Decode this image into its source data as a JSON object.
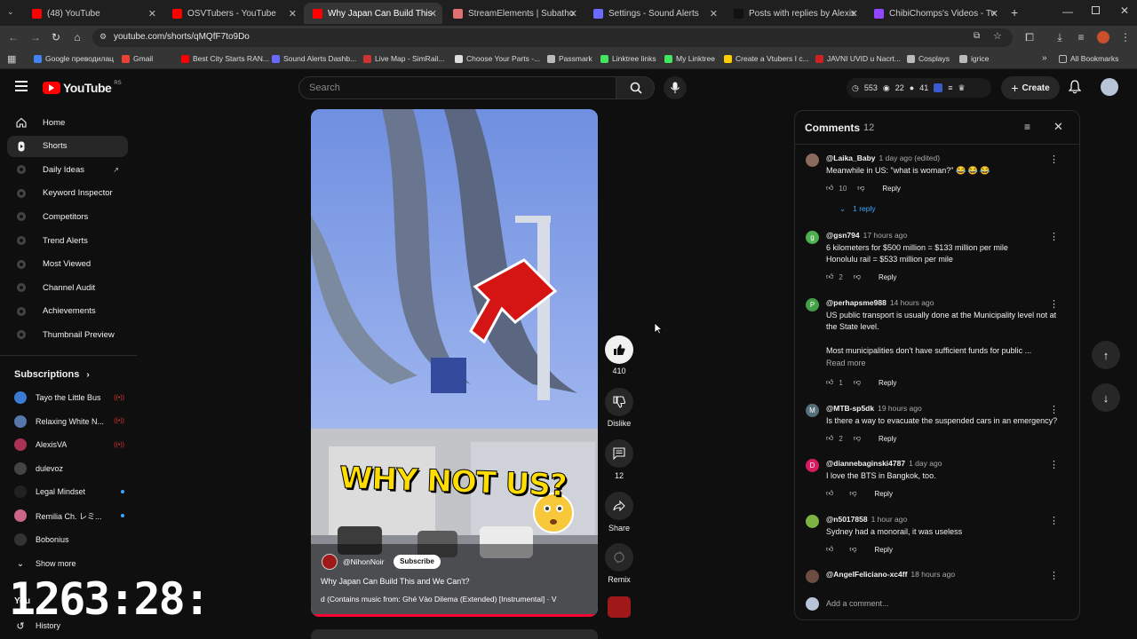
{
  "browser": {
    "tabs": [
      {
        "title": "(48) YouTube",
        "color": "#ff0000",
        "active": false
      },
      {
        "title": "OSVTubers - YouTube",
        "color": "#ff0000",
        "active": false
      },
      {
        "title": "Why Japan Can Build This a",
        "color": "#ff0000",
        "active": true
      },
      {
        "title": "StreamElements | Subathon Co",
        "color": "#e07070",
        "active": false
      },
      {
        "title": "Settings - Sound Alerts",
        "color": "#6a6aff",
        "active": false
      },
      {
        "title": "Posts with replies by Alexis 2.c",
        "color": "#111111",
        "active": false
      },
      {
        "title": "ChibiChomps's Videos - Twitch",
        "color": "#9146ff",
        "active": false
      }
    ],
    "url": "youtube.com/shorts/qMQfF7to9Do",
    "bookmarks": [
      {
        "label": "Google преводилац",
        "color": "#4285f4"
      },
      {
        "label": "Gmail",
        "color": "#ea4335"
      },
      {
        "label": "Best City Starts RAN...",
        "color": "#ff0000"
      },
      {
        "label": "Sound Alerts Dashb...",
        "color": "#6a6aff"
      },
      {
        "label": "Live Map - SimRail...",
        "color": "#cc3333"
      },
      {
        "label": "Choose Your Parts -...",
        "color": "#dddddd"
      },
      {
        "label": "Passmark",
        "color": "#bbbbbb"
      },
      {
        "label": "Linktree links",
        "color": "#43e660"
      },
      {
        "label": "My Linktree",
        "color": "#43e660"
      },
      {
        "label": "Create a Vtubers I c...",
        "color": "#ffcc00"
      },
      {
        "label": "JAVNI UVID u Nacrt...",
        "color": "#cc2222"
      },
      {
        "label": "Cosplays",
        "color": "#bbbbbb"
      },
      {
        "label": "igrice",
        "color": "#bbbbbb"
      }
    ],
    "all_bookmarks": "All Bookmarks"
  },
  "youtube": {
    "logo_text": "YouTube",
    "logo_region": "RS",
    "search_placeholder": "Search",
    "stats": {
      "a": "553",
      "b": "22",
      "c": "41"
    },
    "create_label": "Create"
  },
  "sidebar": {
    "items": [
      {
        "label": "Home",
        "icon": "home-icon"
      },
      {
        "label": "Shorts",
        "icon": "shorts-icon"
      },
      {
        "label": "Daily Ideas",
        "icon": "ext-icon"
      },
      {
        "label": "Keyword Inspector",
        "icon": "ext-icon"
      },
      {
        "label": "Competitors",
        "icon": "ext-icon"
      },
      {
        "label": "Trend Alerts",
        "icon": "ext-icon"
      },
      {
        "label": "Most Viewed",
        "icon": "ext-icon"
      },
      {
        "label": "Channel Audit",
        "icon": "ext-icon"
      },
      {
        "label": "Achievements",
        "icon": "ext-icon"
      },
      {
        "label": "Thumbnail Preview",
        "icon": "ext-icon"
      }
    ],
    "subscriptions_label": "Subscriptions",
    "subscriptions": [
      {
        "name": "Tayo the Little Bus",
        "badge": "live",
        "color": "#3a7bd5"
      },
      {
        "name": "Relaxing White N...",
        "badge": "live",
        "color": "#5577aa"
      },
      {
        "name": "AlexisVA",
        "badge": "live",
        "color": "#aa3355"
      },
      {
        "name": "dulevoz",
        "badge": "",
        "color": "#444444"
      },
      {
        "name": "Legal Mindset",
        "badge": "dot",
        "color": "#222222"
      },
      {
        "name": "Remilia Ch. レミ...",
        "badge": "dot",
        "color": "#cc6688"
      },
      {
        "name": "Bobonius",
        "badge": "",
        "color": "#333333"
      }
    ],
    "show_more": "Show more",
    "you_label": "You",
    "history_label": "History"
  },
  "overlay_timer": "1263:28:",
  "video": {
    "overlay_text": "WHY NOT US?",
    "channel": "@NihonNoir",
    "subscribe": "Subscribe",
    "title": "Why Japan Can Build This and We Can't?",
    "music": "d (Contains music from: Ghé Vào Dilema (Extended) [Instrumental] · V"
  },
  "actions": {
    "likes": "410",
    "dislike": "Dislike",
    "comments": "12",
    "share": "Share",
    "remix": "Remix"
  },
  "comments": {
    "title": "Comments",
    "count": "12",
    "add_placeholder": "Add a comment...",
    "reply_label": "Reply",
    "read_more": "Read more",
    "items": [
      {
        "author": "@Laika_Baby",
        "time": "1 day ago (edited)",
        "text": "Meanwhile in US: \"what is woman?\" 😂 😂 😂",
        "likes": "10",
        "avatar_color": "#8a6a5a",
        "avatar_letter": "",
        "replies": "1 reply"
      },
      {
        "author": "@gsn794",
        "time": "17 hours ago",
        "text": "6 kilometers for $500 million = $133 million per mile\nHonolulu rail = $533 million per mile",
        "likes": "2",
        "avatar_color": "#4caf50",
        "avatar_letter": "g"
      },
      {
        "author": "@perhapsme988",
        "time": "14 hours ago",
        "text": "US public transport is usually  done at the Municipality level not at the State level.",
        "text2": "Most municipalities don't have sufficient funds for public ...",
        "likes": "1",
        "avatar_color": "#43a047",
        "avatar_letter": "P"
      },
      {
        "author": "@MTB-sp5dk",
        "time": "19 hours ago",
        "text": "Is there a way to evacuate the suspended cars in an emergency?",
        "likes": "2",
        "avatar_color": "#546e7a",
        "avatar_letter": "M"
      },
      {
        "author": "@diannebaginski4787",
        "time": "1 day ago",
        "text": "I love the BTS in Bangkok, too.",
        "likes": "",
        "avatar_color": "#d81b60",
        "avatar_letter": "D"
      },
      {
        "author": "@n5017858",
        "time": "1 hour ago",
        "text": "Sydney had a monorail, it was useless",
        "likes": "",
        "avatar_color": "#7cb342",
        "avatar_letter": ""
      },
      {
        "author": "@AngelFeliciano-xc4ff",
        "time": "18 hours ago",
        "text": "",
        "likes": "",
        "avatar_color": "#6d4c41",
        "avatar_letter": ""
      }
    ]
  }
}
